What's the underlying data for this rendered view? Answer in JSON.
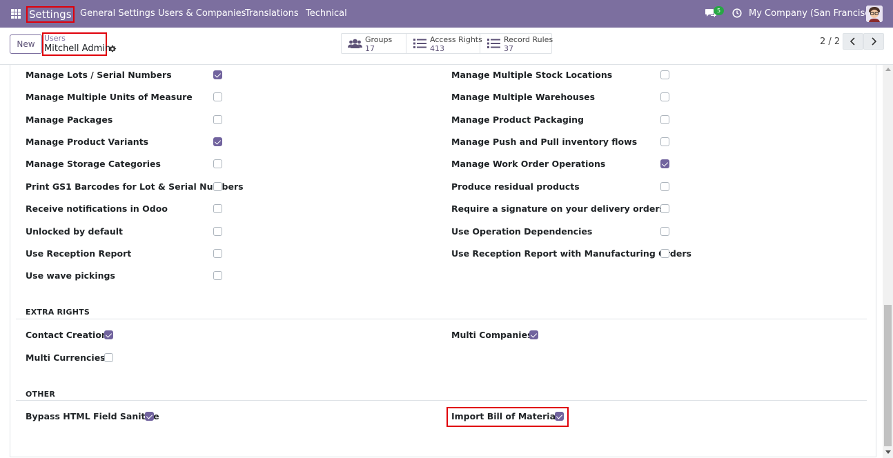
{
  "navbar": {
    "brand": "Settings",
    "menu": [
      {
        "label": "General Settings"
      },
      {
        "label": "Users & Companies"
      },
      {
        "label": "Translations"
      },
      {
        "label": "Technical"
      }
    ],
    "chat_count": "5",
    "company": "My Company (San Francisco)",
    "icons": [
      "apps-grid-icon",
      "chat-icon",
      "clock-icon",
      "avatar"
    ]
  },
  "control": {
    "new_label": "New",
    "breadcrumb_parent": "Users",
    "breadcrumb_current": "Mitchell Admin",
    "smart_buttons": [
      {
        "label": "Groups",
        "count": "17",
        "icon": "users-icon"
      },
      {
        "label": "Access Rights",
        "count": "413",
        "icon": "list-icon"
      },
      {
        "label": "Record Rules",
        "count": "37",
        "icon": "list-icon"
      }
    ],
    "pager": "2 / 2"
  },
  "colors": {
    "navbar": "#7c6f9f",
    "checkbox_checked": "#71639e",
    "highlight": "#e0000a"
  },
  "inventory_rights": {
    "left": [
      {
        "label": "Manage Lots / Serial Numbers",
        "checked": true
      },
      {
        "label": "Manage Multiple Units of Measure",
        "checked": false
      },
      {
        "label": "Manage Packages",
        "checked": false
      },
      {
        "label": "Manage Product Variants",
        "checked": true
      },
      {
        "label": "Manage Storage Categories",
        "checked": false
      },
      {
        "label": "Print GS1 Barcodes for Lot & Serial Numbers",
        "checked": false
      },
      {
        "label": "Receive notifications in Odoo",
        "checked": false
      },
      {
        "label": "Unlocked by default",
        "checked": false
      },
      {
        "label": "Use Reception Report",
        "checked": false
      },
      {
        "label": "Use wave pickings",
        "checked": false
      }
    ],
    "right": [
      {
        "label": "Manage Multiple Stock Locations",
        "checked": false
      },
      {
        "label": "Manage Multiple Warehouses",
        "checked": false
      },
      {
        "label": "Manage Product Packaging",
        "checked": false
      },
      {
        "label": "Manage Push and Pull inventory flows",
        "checked": false
      },
      {
        "label": "Manage Work Order Operations",
        "checked": true
      },
      {
        "label": "Produce residual products",
        "checked": false
      },
      {
        "label": "Require a signature on your delivery orders",
        "checked": false
      },
      {
        "label": "Use Operation Dependencies",
        "checked": false
      },
      {
        "label": "Use Reception Report with Manufacturing Orders",
        "checked": false
      }
    ]
  },
  "extra_rights": {
    "title": "EXTRA RIGHTS",
    "items": [
      {
        "label": "Contact Creation",
        "checked": true
      },
      {
        "label": "Multi Companies",
        "checked": true
      },
      {
        "label": "Multi Currencies",
        "checked": false
      }
    ]
  },
  "other": {
    "title": "OTHER",
    "items": [
      {
        "label": "Bypass HTML Field Sanitize",
        "checked": true
      },
      {
        "label": "Import Bill of Materials",
        "checked": true
      }
    ]
  }
}
